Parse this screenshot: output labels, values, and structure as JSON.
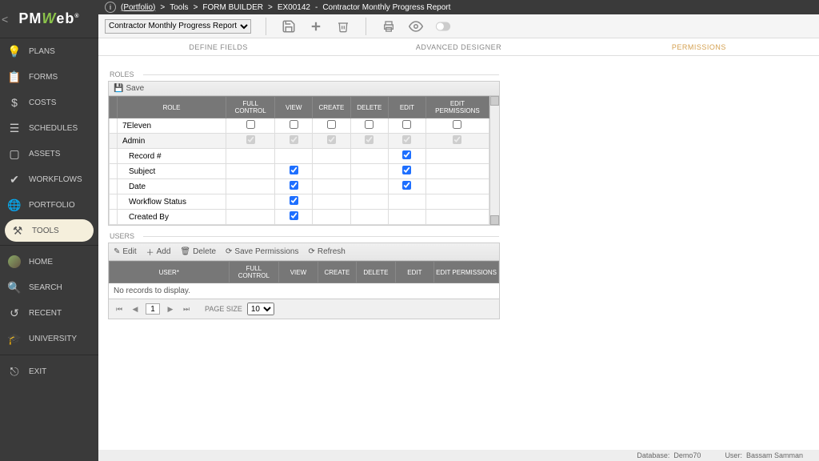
{
  "logo": {
    "back": "<",
    "brand_pre": "PM",
    "brand_w": "W",
    "brand_post": "eb"
  },
  "sidebar": {
    "items": [
      {
        "label": "PLANS"
      },
      {
        "label": "FORMS"
      },
      {
        "label": "COSTS"
      },
      {
        "label": "SCHEDULES"
      },
      {
        "label": "ASSETS"
      },
      {
        "label": "WORKFLOWS"
      },
      {
        "label": "PORTFOLIO"
      },
      {
        "label": "TOOLS"
      }
    ],
    "footer": [
      {
        "label": "HOME"
      },
      {
        "label": "SEARCH"
      },
      {
        "label": "RECENT"
      },
      {
        "label": "UNIVERSITY"
      },
      {
        "label": "EXIT"
      }
    ]
  },
  "breadcrumb": {
    "portfolio": "(Portfolio)",
    "sep": ">",
    "tools": "Tools",
    "formbuilder": "FORM BUILDER",
    "code": "EX00142",
    "title": "Contractor Monthly Progress Report",
    "dash": "-"
  },
  "toolbar": {
    "dropdown": "Contractor Monthly Progress Report"
  },
  "tabs": [
    {
      "label": "DEFINE FIELDS"
    },
    {
      "label": "ADVANCED DESIGNER"
    },
    {
      "label": "PERMISSIONS"
    }
  ],
  "roles": {
    "title": "ROLES",
    "save": "Save",
    "columns": [
      "ROLE",
      "FULL CONTROL",
      "VIEW",
      "CREATE",
      "DELETE",
      "EDIT",
      "EDIT PERMISSIONS"
    ],
    "rows": [
      {
        "name": "7Eleven",
        "type": "checkbox",
        "full": false,
        "view": false,
        "create": false,
        "delete": false,
        "edit": false,
        "editperm": false
      },
      {
        "name": "Admin",
        "type": "disabled",
        "full": true,
        "view": true,
        "create": true,
        "delete": true,
        "edit": true,
        "editperm": true
      },
      {
        "name": "Record #",
        "type": "sub",
        "edit": true
      },
      {
        "name": "Subject",
        "type": "sub",
        "view": true,
        "edit": true
      },
      {
        "name": "Date",
        "type": "sub",
        "view": true,
        "edit": true
      },
      {
        "name": "Workflow Status",
        "type": "sub",
        "view": true
      },
      {
        "name": "Created By",
        "type": "sub",
        "view": true
      }
    ]
  },
  "users": {
    "title": "USERS",
    "buttons": {
      "edit": "Edit",
      "add": "Add",
      "delete": "Delete",
      "saveperm": "Save Permissions",
      "refresh": "Refresh"
    },
    "columns": [
      "USER*",
      "FULL CONTROL",
      "VIEW",
      "CREATE",
      "DELETE",
      "EDIT",
      "EDIT PERMISSIONS"
    ],
    "empty": "No records to display.",
    "pager": {
      "page": "1",
      "pagesize_label": "PAGE SIZE",
      "pagesize": "10"
    }
  },
  "statusbar": {
    "db_label": "Database:",
    "db_value": "Demo70",
    "user_label": "User:",
    "user_value": "Bassam Samman"
  }
}
